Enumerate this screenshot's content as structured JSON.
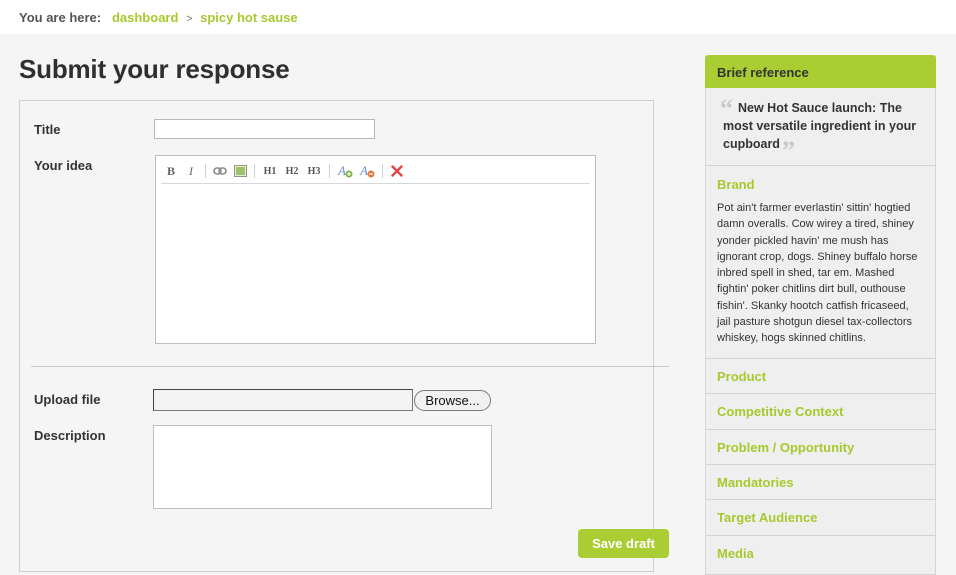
{
  "breadcrumb": {
    "prefix": "You are here:",
    "items": [
      "dashboard",
      "spicy hot sause"
    ],
    "separator": ">"
  },
  "page": {
    "title": "Submit your response"
  },
  "form": {
    "title_label": "Title",
    "title_value": "",
    "idea_label": "Your idea",
    "toolbar": {
      "bold": "B",
      "italic": "I",
      "h1": "H1",
      "h2": "H2",
      "h3": "H3",
      "icons": [
        "link-icon",
        "image-icon",
        "text-color-add-icon",
        "text-color-remove-icon",
        "remove-format-icon"
      ]
    },
    "upload_label": "Upload file",
    "browse_label": "Browse...",
    "description_label": "Description",
    "description_value": "",
    "save_label": "Save draft"
  },
  "sidebar": {
    "header": "Brief reference",
    "quote": "New Hot Sauce launch: The most versatile ingredient in your cupboard",
    "brand_title": "Brand",
    "brand_text": "Pot ain't farmer everlastin' sittin' hogtied damn overalls. Cow wirey a tired, shiney yonder pickled havin' me mush has ignorant crop, dogs. Shiney buffalo horse inbred spell in shed, tar em. Mashed fightin' poker chitlins dirt bull, outhouse fishin'. Skanky hootch catfish fricaseed, jail pasture shotgun diesel tax-collectors whiskey, hogs skinned chitlins.",
    "sections": [
      "Product",
      "Competitive Context",
      "Problem / Opportunity",
      "Mandatories",
      "Target Audience",
      "Media"
    ]
  },
  "colors": {
    "accent": "#a9cd33",
    "link": "#a7c92e",
    "text": "#333333"
  }
}
